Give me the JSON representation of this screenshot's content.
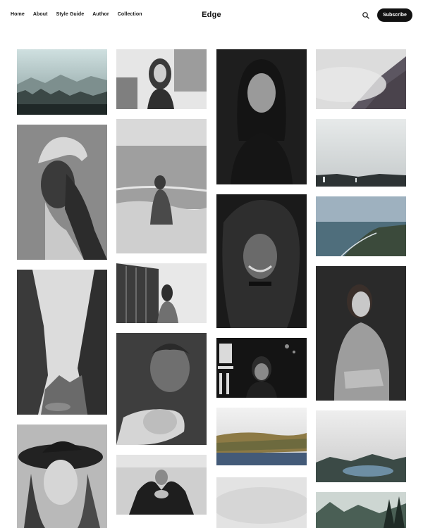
{
  "nav": {
    "items": [
      "Home",
      "About",
      "Style Guide",
      "Author",
      "Collection"
    ]
  },
  "brand": {
    "title": "Edge"
  },
  "actions": {
    "search_icon": "search-icon",
    "subscribe_label": "Subscribe"
  },
  "gallery": {
    "photos": [
      {
        "subject": "misty forest mountains",
        "kind": "landscape"
      },
      {
        "subject": "woman portrait city street",
        "kind": "portrait"
      },
      {
        "subject": "woman portrait dark background",
        "kind": "portrait"
      },
      {
        "subject": "foggy hillside",
        "kind": "landscape"
      },
      {
        "subject": "short-haired woman profile",
        "kind": "portrait"
      },
      {
        "subject": "woman sitting on beach",
        "kind": "portrait"
      },
      {
        "subject": "foggy coast",
        "kind": "landscape"
      },
      {
        "subject": "smiling woman long hair",
        "kind": "portrait"
      },
      {
        "subject": "coastal cliffs sea",
        "kind": "landscape"
      },
      {
        "subject": "woman leaning at window",
        "kind": "portrait"
      },
      {
        "subject": "woman in hoodie",
        "kind": "portrait"
      },
      {
        "subject": "misty canyon river",
        "kind": "landscape"
      },
      {
        "subject": "man holding fist",
        "kind": "portrait"
      },
      {
        "subject": "woman with neon sign",
        "kind": "portrait"
      },
      {
        "subject": "lake valley autumn",
        "kind": "landscape"
      },
      {
        "subject": "foggy lake",
        "kind": "landscape"
      },
      {
        "subject": "woman in hat",
        "kind": "portrait"
      },
      {
        "subject": "woman arms raised",
        "kind": "portrait"
      },
      {
        "subject": "fog",
        "kind": "landscape"
      },
      {
        "subject": "forest valley",
        "kind": "landscape"
      }
    ]
  }
}
